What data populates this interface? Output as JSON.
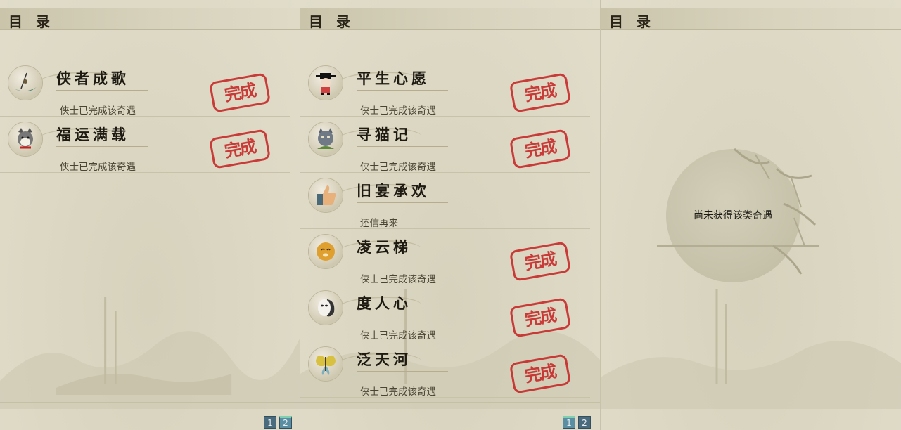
{
  "panels": [
    {
      "title": "目 录",
      "rows": [
        {
          "title": "侠者成歌",
          "status": "侠士已完成该奇遇",
          "completed": true,
          "icon": "boat-fisher-icon"
        },
        {
          "title": "福运满载",
          "status": "侠士已完成该奇遇",
          "completed": true,
          "icon": "husky-dog-icon"
        }
      ],
      "pages": [
        "1",
        "2"
      ],
      "active_page": "2"
    },
    {
      "title": "目 录",
      "rows": [
        {
          "title": "平生心愿",
          "status": "侠士已完成该奇遇",
          "completed": true,
          "icon": "scholar-figure-icon"
        },
        {
          "title": "寻猫记",
          "status": "侠士已完成该奇遇",
          "completed": true,
          "icon": "cat-icon"
        },
        {
          "title": "旧宴承欢",
          "status": "还信再来",
          "completed": false,
          "icon": "thumbs-up-icon"
        },
        {
          "title": "凌云梯",
          "status": "侠士已完成该奇遇",
          "completed": true,
          "icon": "fox-face-icon"
        },
        {
          "title": "度人心",
          "status": "侠士已完成该奇遇",
          "completed": true,
          "icon": "mask-icon"
        },
        {
          "title": "泛天河",
          "status": "侠士已完成该奇遇",
          "completed": true,
          "icon": "butterfly-icon"
        }
      ],
      "pages": [
        "1",
        "2"
      ],
      "active_page": "1"
    },
    {
      "title": "目 录",
      "rows": [],
      "empty_text": "尚未获得该类奇遇"
    }
  ],
  "stamp_text": "完成",
  "colors": {
    "stamp": "#c62020",
    "page_button": "#4a6b7d",
    "page_button_active": "#5a8ea3"
  }
}
